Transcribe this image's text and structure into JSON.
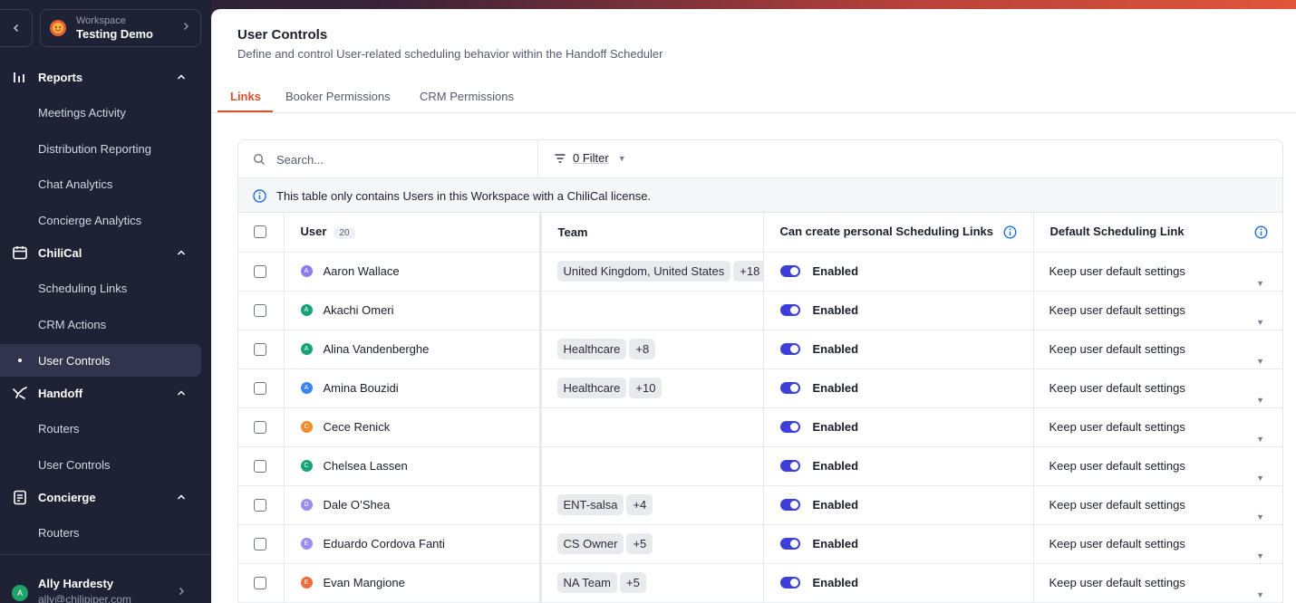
{
  "workspace": {
    "label": "Workspace",
    "name": "Testing Demo"
  },
  "sidebar": {
    "sections": [
      {
        "label": "Reports",
        "icon": "bar-chart-icon",
        "items": [
          "Meetings Activity",
          "Distribution Reporting",
          "Chat Analytics",
          "Concierge Analytics"
        ]
      },
      {
        "label": "ChiliCal",
        "icon": "calendar-icon",
        "items": [
          "Scheduling Links",
          "CRM Actions",
          "User Controls"
        ]
      },
      {
        "label": "Handoff",
        "icon": "handoff-icon",
        "items": [
          "Routers",
          "User Controls"
        ]
      },
      {
        "label": "Concierge",
        "icon": "clipboard-icon",
        "items": [
          "Routers"
        ]
      }
    ],
    "active_item": "User Controls",
    "user": {
      "name": "Ally Hardesty",
      "email": "ally@chilipiper.com",
      "initial": "A"
    }
  },
  "page": {
    "title": "User Controls",
    "subtitle": "Define and control User-related scheduling behavior within the Handoff Scheduler"
  },
  "tabs": [
    "Links",
    "Booker Permissions",
    "CRM Permissions"
  ],
  "active_tab": "Links",
  "toolbar": {
    "search_placeholder": "Search...",
    "filter_label": "0 Filter"
  },
  "notice": "This table only contains Users in this Workspace with a ChiliCal license.",
  "table": {
    "headers": {
      "user": "User",
      "user_count": "20",
      "team": "Team",
      "can_create": "Can create personal Scheduling Links",
      "default_link": "Default Scheduling Link"
    },
    "rows": [
      {
        "initial": "A",
        "color": "#8b7cf0",
        "name": "Aaron Wallace",
        "teams": [
          "United Kingdom, United States",
          "+18"
        ],
        "enabled": "Enabled",
        "default": "Keep user default settings"
      },
      {
        "initial": "A",
        "color": "#17a37a",
        "name": "Akachi Omeri",
        "teams": [],
        "enabled": "Enabled",
        "default": "Keep user default settings"
      },
      {
        "initial": "A",
        "color": "#17a37a",
        "name": "Alina Vandenberghe",
        "teams": [
          "Healthcare",
          "+8"
        ],
        "enabled": "Enabled",
        "default": "Keep user default settings"
      },
      {
        "initial": "A",
        "color": "#3b82f6",
        "name": "Amina Bouzidi",
        "teams": [
          "Healthcare",
          "+10"
        ],
        "enabled": "Enabled",
        "default": "Keep user default settings"
      },
      {
        "initial": "C",
        "color": "#f28b2a",
        "name": "Cece Renick",
        "teams": [],
        "enabled": "Enabled",
        "default": "Keep user default settings"
      },
      {
        "initial": "C",
        "color": "#17a37a",
        "name": "Chelsea Lassen",
        "teams": [],
        "enabled": "Enabled",
        "default": "Keep user default settings"
      },
      {
        "initial": "D",
        "color": "#9a8cf0",
        "name": "Dale O’Shea",
        "teams": [
          "ENT-salsa",
          "+4"
        ],
        "enabled": "Enabled",
        "default": "Keep user default settings"
      },
      {
        "initial": "E",
        "color": "#9a8cf0",
        "name": "Eduardo Cordova Fanti",
        "teams": [
          "CS Owner",
          "+5"
        ],
        "enabled": "Enabled",
        "default": "Keep user default settings"
      },
      {
        "initial": "E",
        "color": "#ef6a3c",
        "name": "Evan Mangione",
        "teams": [
          "NA Team",
          "+5"
        ],
        "enabled": "Enabled",
        "default": "Keep user default settings"
      }
    ]
  },
  "colors": {
    "accent": "#d7512d",
    "toggle": "#3c3fd8",
    "sidebar": "#1e2234"
  }
}
